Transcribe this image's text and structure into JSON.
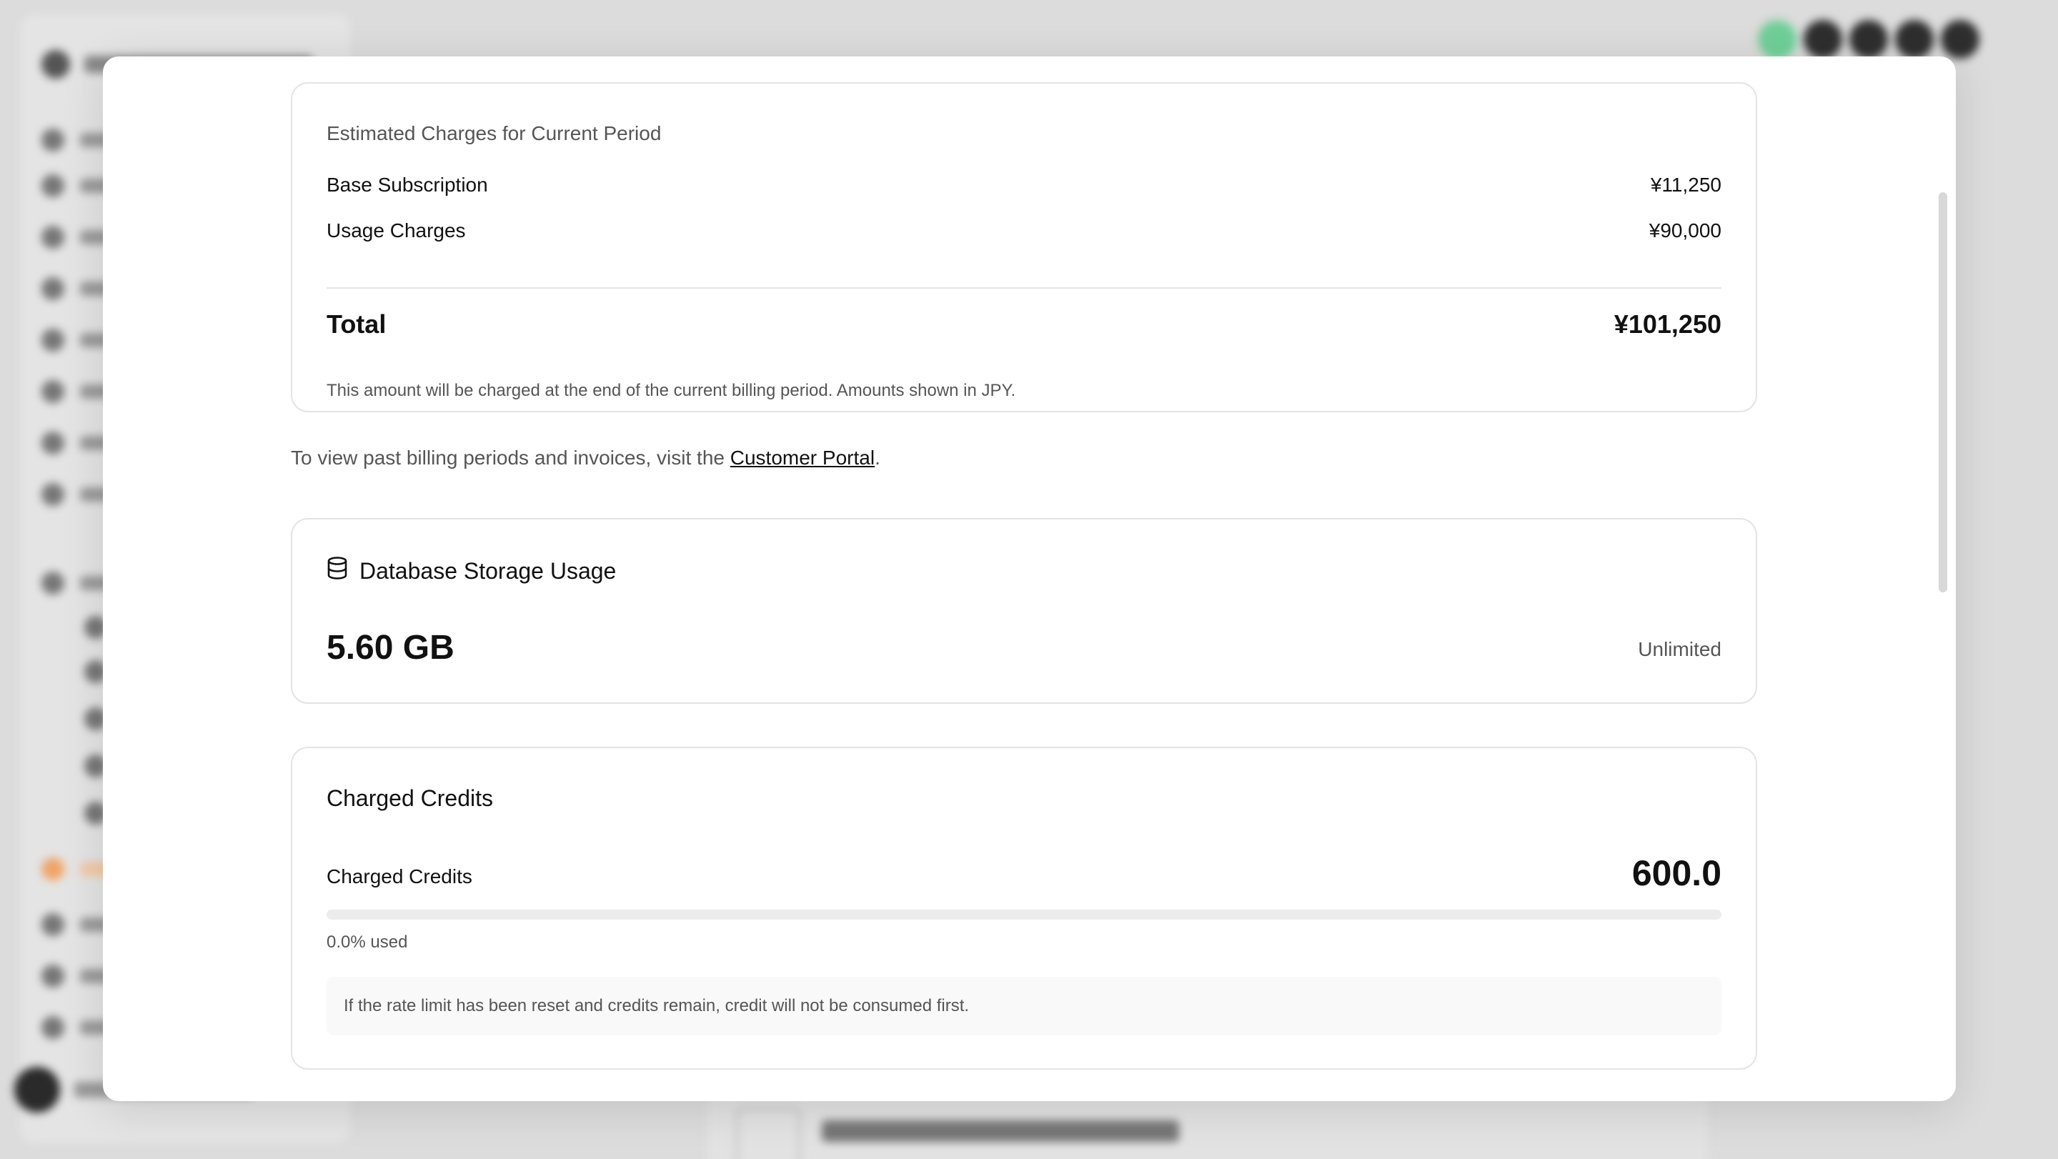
{
  "charges": {
    "title": "Estimated Charges for Current Period",
    "base_label": "Base Subscription",
    "base_value": "¥11,250",
    "usage_label": "Usage Charges",
    "usage_value": "¥90,000",
    "total_label": "Total",
    "total_value": "¥101,250",
    "note": "This amount will be charged at the end of the current billing period. Amounts shown in JPY."
  },
  "portal": {
    "prefix": "To view past billing periods and invoices, visit the ",
    "link_label": "Customer Portal",
    "suffix": "."
  },
  "storage": {
    "icon": "database-icon",
    "title": "Database Storage Usage",
    "value": "5.60 GB",
    "limit": "Unlimited"
  },
  "credits": {
    "title": "Charged Credits",
    "label": "Charged Credits",
    "value": "600.0",
    "used_fraction": 0.0,
    "used_text": "0.0% used",
    "note": "If the rate limit has been reset and credits remain, credit will not be consumed first."
  },
  "colors": {
    "progress_fill": "#111111",
    "progress_track": "#ececec"
  }
}
